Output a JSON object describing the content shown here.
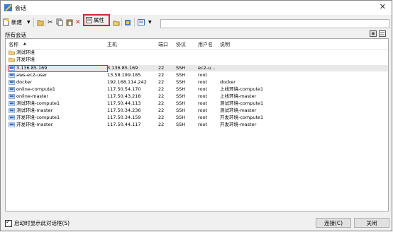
{
  "window": {
    "title": "会话"
  },
  "toolbar": {
    "new_label": "新建",
    "properties_label": "属性",
    "search_placeholder": ""
  },
  "panel": {
    "title": "所有会话"
  },
  "columns": [
    "名称",
    "主机",
    "端口",
    "协议",
    "用户名",
    "说明"
  ],
  "folders": [
    "测试环境",
    "开发环境"
  ],
  "sessions": [
    {
      "name": "3.136.85.169",
      "host": "3.136.85.169",
      "port": "22",
      "protocol": "SSH",
      "user": "ec2-u...",
      "desc": ""
    },
    {
      "name": "aws-ec2-user",
      "host": "13.58.199.185",
      "port": "22",
      "protocol": "SSH",
      "user": "root",
      "desc": ""
    },
    {
      "name": "docker",
      "host": "192.168.114.242",
      "port": "22",
      "protocol": "SSH",
      "user": "root",
      "desc": "docker"
    },
    {
      "name": "online-compute1",
      "host": "117.50.54.170",
      "port": "22",
      "protocol": "SSH",
      "user": "root",
      "desc": "上线环境-compute1"
    },
    {
      "name": "online-master",
      "host": "117.50.43.218",
      "port": "22",
      "protocol": "SSH",
      "user": "root",
      "desc": "上线环境-master"
    },
    {
      "name": "测试环境-compute1",
      "host": "117.50.44.113",
      "port": "22",
      "protocol": "SSH",
      "user": "root",
      "desc": "测试环境-compute1"
    },
    {
      "name": "测试环境-master",
      "host": "117.50.34.236",
      "port": "22",
      "protocol": "SSH",
      "user": "root",
      "desc": "测试环境-master"
    },
    {
      "name": "开发环境-compute1",
      "host": "117.50.34.159",
      "port": "22",
      "protocol": "SSH",
      "user": "root",
      "desc": "开发环境-compute1"
    },
    {
      "name": "开发环境-master",
      "host": "117.50.44.117",
      "port": "22",
      "protocol": "SSH",
      "user": "root",
      "desc": "开发环境-master"
    }
  ],
  "footer": {
    "startup_label": "启动时显示此对话框(S)",
    "connect_label": "连接(C)",
    "close_label": "关闭"
  }
}
